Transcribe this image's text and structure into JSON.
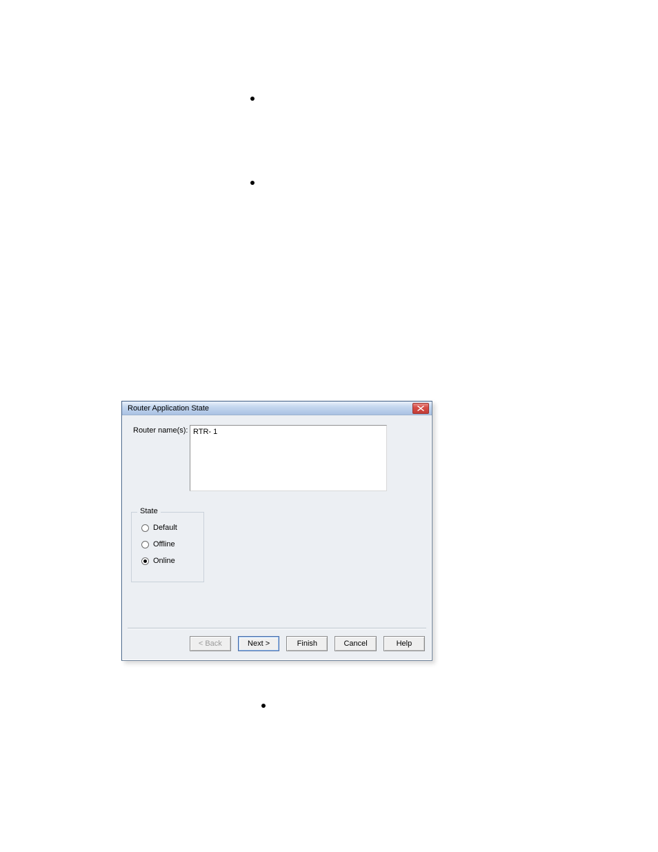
{
  "bullets": {
    "b1": "",
    "b2": "",
    "b3": ""
  },
  "dialog": {
    "title": "Router Application State",
    "router_names_label": "Router name(s):",
    "router_items": [
      "RTR- 1"
    ],
    "state": {
      "legend": "State",
      "options": {
        "default": "Default",
        "offline": "Offline",
        "online": "Online"
      },
      "selected": "online"
    },
    "buttons": {
      "back": "< Back",
      "next": "Next >",
      "finish": "Finish",
      "cancel": "Cancel",
      "help": "Help"
    }
  }
}
